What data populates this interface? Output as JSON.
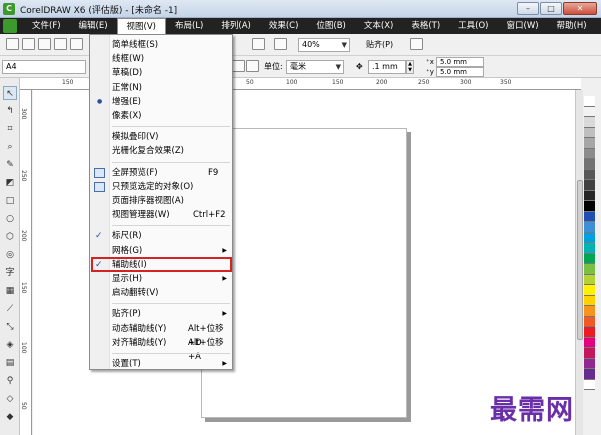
{
  "window": {
    "title": "CorelDRAW X6 (评估版) - [未命名 -1]"
  },
  "menubar": [
    {
      "label": "文件(F)",
      "active": false
    },
    {
      "label": "编辑(E)",
      "active": false
    },
    {
      "label": "视图(V)",
      "active": true
    },
    {
      "label": "布局(L)",
      "active": false
    },
    {
      "label": "排列(A)",
      "active": false
    },
    {
      "label": "效果(C)",
      "active": false
    },
    {
      "label": "位图(B)",
      "active": false
    },
    {
      "label": "文本(X)",
      "active": false
    },
    {
      "label": "表格(T)",
      "active": false
    },
    {
      "label": "工具(O)",
      "active": false
    },
    {
      "label": "窗口(W)",
      "active": false
    },
    {
      "label": "帮助(H)",
      "active": false
    }
  ],
  "toolbar": {
    "zoom": "40%",
    "snap": "贴齐(P)",
    "page_size": "A4",
    "unit_label": "单位:",
    "unit_value": "毫米",
    "nudge": ".1 mm",
    "dup_x": "5.0 mm",
    "dup_y": "5.0 mm"
  },
  "ruler": {
    "top_ticks": [
      "150",
      "100",
      "50",
      "50",
      "100",
      "150",
      "200",
      "250",
      "300",
      "350"
    ],
    "left_ticks": [
      "300",
      "250",
      "200",
      "150",
      "100",
      "50"
    ]
  },
  "view_menu": {
    "items": [
      {
        "label": "简单线框(S)"
      },
      {
        "label": "线框(W)"
      },
      {
        "label": "草稿(D)"
      },
      {
        "label": "正常(N)"
      },
      {
        "label": "增强(E)",
        "marker": "dot"
      },
      {
        "label": "像素(X)"
      },
      {
        "sep": true
      },
      {
        "label": "模拟叠印(V)"
      },
      {
        "label": "光栅化复合效果(Z)"
      },
      {
        "sep": true
      },
      {
        "label": "全屏预览(F)",
        "shortcut": "F9",
        "icon": true
      },
      {
        "label": "只预览选定的对象(O)",
        "icon": true
      },
      {
        "label": "页面排序器视图(A)"
      },
      {
        "label": "视图管理器(W)",
        "shortcut": "Ctrl+F2"
      },
      {
        "sep": true
      },
      {
        "label": "标尺(R)",
        "marker": "check"
      },
      {
        "label": "网格(G)",
        "submenu": true
      },
      {
        "label": "辅助线(I)",
        "marker": "check",
        "highlighted": true
      },
      {
        "label": "显示(H)",
        "submenu": true
      },
      {
        "label": "启动翻转(V)"
      },
      {
        "sep": true
      },
      {
        "label": "贴齐(P)",
        "submenu": true
      },
      {
        "label": "动态辅助线(Y)",
        "shortcut": "Alt+位移+D"
      },
      {
        "label": "对齐辅助线(Y)",
        "shortcut": "Alt+位移+A"
      },
      {
        "sep": true
      },
      {
        "label": "设置(T)",
        "submenu": true
      }
    ]
  },
  "palette": [
    "#ffffff",
    "#f2f2f2",
    "#d9d9d9",
    "#bfbfbf",
    "#a6a6a6",
    "#8c8c8c",
    "#737373",
    "#595959",
    "#404040",
    "#262626",
    "#000000",
    "#1e50b4",
    "#3f8fd8",
    "#00a0e0",
    "#00b3b3",
    "#00a651",
    "#7ac143",
    "#b3d234",
    "#fff200",
    "#ffd200",
    "#f7941d",
    "#f15a24",
    "#ed1c24",
    "#e6007e",
    "#c2185b",
    "#92278f",
    "#662d91",
    "#ffffff"
  ],
  "watermark": "最需网"
}
